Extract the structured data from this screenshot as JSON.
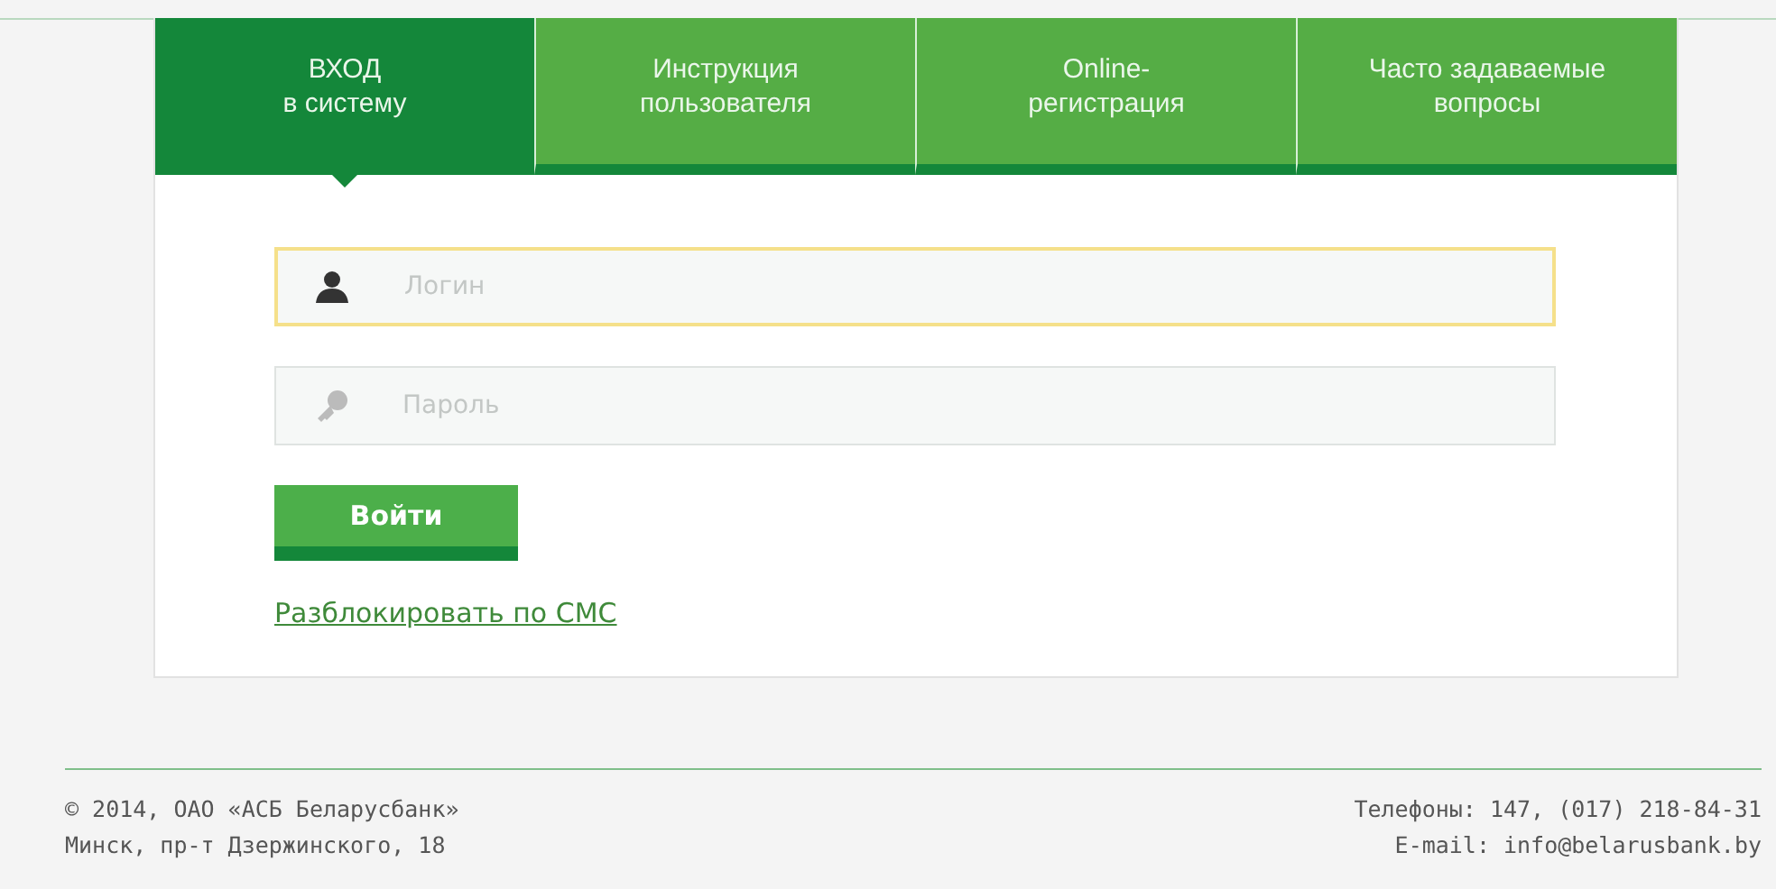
{
  "tabs": [
    {
      "lines": [
        "ВХОД",
        "в систему"
      ],
      "selected": true
    },
    {
      "lines": [
        "Инструкция",
        "пользователя"
      ],
      "selected": false
    },
    {
      "lines": [
        "Online-",
        "регистрация"
      ],
      "selected": false
    },
    {
      "lines": [
        "Часто задаваемые",
        "вопросы"
      ],
      "selected": false
    }
  ],
  "login": {
    "placeholder": "Логин",
    "focused": true
  },
  "password": {
    "placeholder": "Пароль",
    "focused": false
  },
  "submit": "Войти",
  "unlock_link": "Разблокировать по СМС",
  "footer": {
    "left": [
      "© 2014, ОАО «АСБ Беларусбанк»",
      "Минск, пр-т Дзержинского, 18"
    ],
    "right": [
      "Телефоны: 147, (017) 218-84-31",
      "E-mail: info@belarusbank.by"
    ]
  }
}
